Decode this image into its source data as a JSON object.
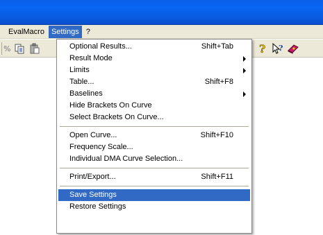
{
  "menubar": {
    "items": [
      {
        "label": "EvalMacro"
      },
      {
        "label": "Settings"
      },
      {
        "label": "?"
      }
    ]
  },
  "toolbar": {
    "left_icons": [
      "percent-icon",
      "copy-icon",
      "paste-icon"
    ],
    "right_icons": [
      "help-question-icon",
      "context-help-icon",
      "book-icon"
    ]
  },
  "settings_menu": {
    "groups": [
      [
        {
          "label": "Optional Results...",
          "shortcut": "Shift+Tab"
        },
        {
          "label": "Result Mode",
          "submenu": true
        },
        {
          "label": "Limits",
          "submenu": true
        },
        {
          "label": "Table...",
          "shortcut": "Shift+F8"
        },
        {
          "label": "Baselines",
          "submenu": true
        },
        {
          "label": "Hide Brackets On Curve"
        },
        {
          "label": "Select Brackets On Curve..."
        }
      ],
      [
        {
          "label": "Open Curve...",
          "shortcut": "Shift+F10"
        },
        {
          "label": "Frequency Scale..."
        },
        {
          "label": "Individual DMA Curve Selection..."
        }
      ],
      [
        {
          "label": "Print/Export...",
          "shortcut": "Shift+F11"
        }
      ],
      [
        {
          "label": "Save Settings",
          "selected": true
        },
        {
          "label": "Restore Settings"
        }
      ]
    ]
  },
  "colors": {
    "titlebar": "#0a5ee6",
    "menu_highlight": "#316ac5",
    "chrome": "#ece9d8"
  }
}
